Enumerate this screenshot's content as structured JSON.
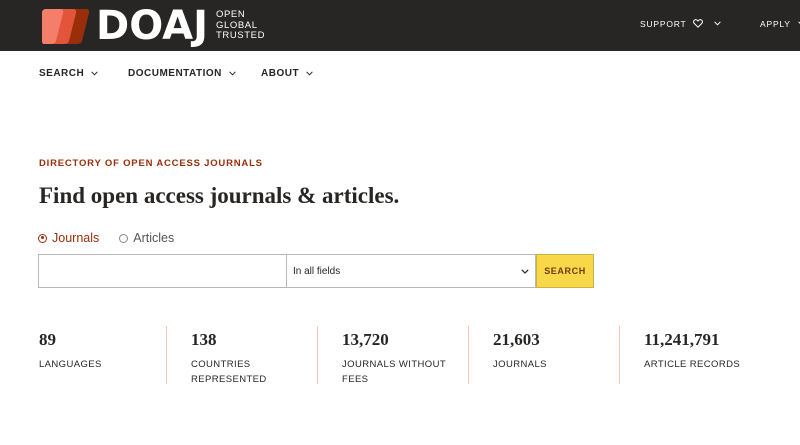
{
  "brand": {
    "name": "DOAJ",
    "tagline": [
      "OPEN",
      "GLOBAL",
      "TRUSTED"
    ],
    "colors": {
      "bar": "#282624",
      "accent1": "#f47e6a",
      "accent2": "#e2553b",
      "accent3": "#982e0a"
    }
  },
  "top_nav": {
    "support": "SUPPORT",
    "apply": "APPLY"
  },
  "sub_nav": {
    "search": "SEARCH",
    "documentation": "DOCUMENTATION",
    "about": "ABOUT"
  },
  "hero": {
    "kicker": "DIRECTORY OF OPEN ACCESS JOURNALS",
    "headline": "Find open access journals & articles."
  },
  "search": {
    "options": [
      {
        "label": "Journals",
        "checked": true
      },
      {
        "label": "Articles",
        "checked": false
      }
    ],
    "query": "",
    "field_selected": "In all fields",
    "button_label": "SEARCH"
  },
  "stats": [
    {
      "value": "89",
      "label": "LANGUAGES"
    },
    {
      "value": "138",
      "label": "COUNTRIES REPRESENTED"
    },
    {
      "value": "13,720",
      "label": "JOURNALS WITHOUT FEES"
    },
    {
      "value": "21,603",
      "label": "JOURNALS"
    },
    {
      "value": "11,241,791",
      "label": "ARTICLE RECORDS"
    }
  ],
  "icons": {
    "support": "heart-icon",
    "dropdown": "chevron-down-icon"
  }
}
